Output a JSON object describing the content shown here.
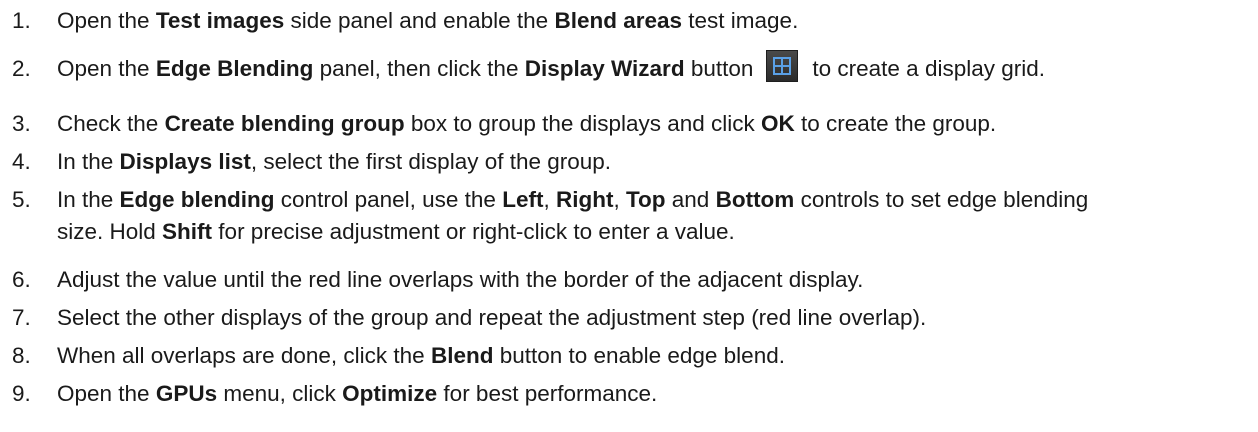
{
  "steps": [
    {
      "num": "1.",
      "segs": [
        {
          "t": "Open the "
        },
        {
          "t": "Test images",
          "b": true
        },
        {
          "t": " side panel and enable the "
        },
        {
          "t": "Blend areas",
          "b": true
        },
        {
          "t": " test image."
        }
      ]
    },
    {
      "num": "2.",
      "segs": [
        {
          "t": "Open the "
        },
        {
          "t": "Edge Blending",
          "b": true
        },
        {
          "t": " panel, then click the "
        },
        {
          "t": "Display Wizard",
          "b": true
        },
        {
          "t": " button"
        },
        {
          "icon": "display-wizard-icon"
        },
        {
          "t": "to create a display grid."
        }
      ]
    },
    {
      "num": "3.",
      "segs": [
        {
          "t": "Check the "
        },
        {
          "t": "Create blending group",
          "b": true
        },
        {
          "t": " box to group the displays and click "
        },
        {
          "t": "OK",
          "b": true
        },
        {
          "t": " to create the group."
        }
      ]
    },
    {
      "num": "4.",
      "segs": [
        {
          "t": "In the "
        },
        {
          "t": "Displays list",
          "b": true
        },
        {
          "t": ", select the first display of the group."
        }
      ]
    },
    {
      "num": "5.",
      "segs": [
        {
          "t": "In the "
        },
        {
          "t": "Edge blending",
          "b": true
        },
        {
          "t": " control panel, use the "
        },
        {
          "t": "Left",
          "b": true
        },
        {
          "t": ", "
        },
        {
          "t": "Right",
          "b": true
        },
        {
          "t": ", "
        },
        {
          "t": "Top",
          "b": true
        },
        {
          "t": " and "
        },
        {
          "t": "Bottom",
          "b": true
        },
        {
          "t": " controls to set edge blending"
        }
      ],
      "line2": [
        {
          "t": "size. Hold "
        },
        {
          "t": "Shift",
          "b": true
        },
        {
          "t": " for precise adjustment or right-click to enter a value."
        }
      ]
    },
    {
      "num": "6.",
      "segs": [
        {
          "t": "Adjust the value until the red line overlaps with the border of the adjacent display."
        }
      ]
    },
    {
      "num": "7.",
      "segs": [
        {
          "t": "Select the other displays of the group and repeat the adjustment step (red line overlap)."
        }
      ]
    },
    {
      "num": "8.",
      "segs": [
        {
          "t": "When all overlaps are done, click the "
        },
        {
          "t": "Blend",
          "b": true
        },
        {
          "t": " button to enable edge blend."
        }
      ]
    },
    {
      "num": "9.",
      "segs": [
        {
          "t": "Open the "
        },
        {
          "t": "GPUs",
          "b": true
        },
        {
          "t": " menu, click "
        },
        {
          "t": "Optimize",
          "b": true
        },
        {
          "t": " for best performance."
        }
      ]
    }
  ],
  "colors": {
    "text": "#1a1a1a",
    "icon_bg": "#333333",
    "icon_glyph": "#5aa0e6"
  }
}
